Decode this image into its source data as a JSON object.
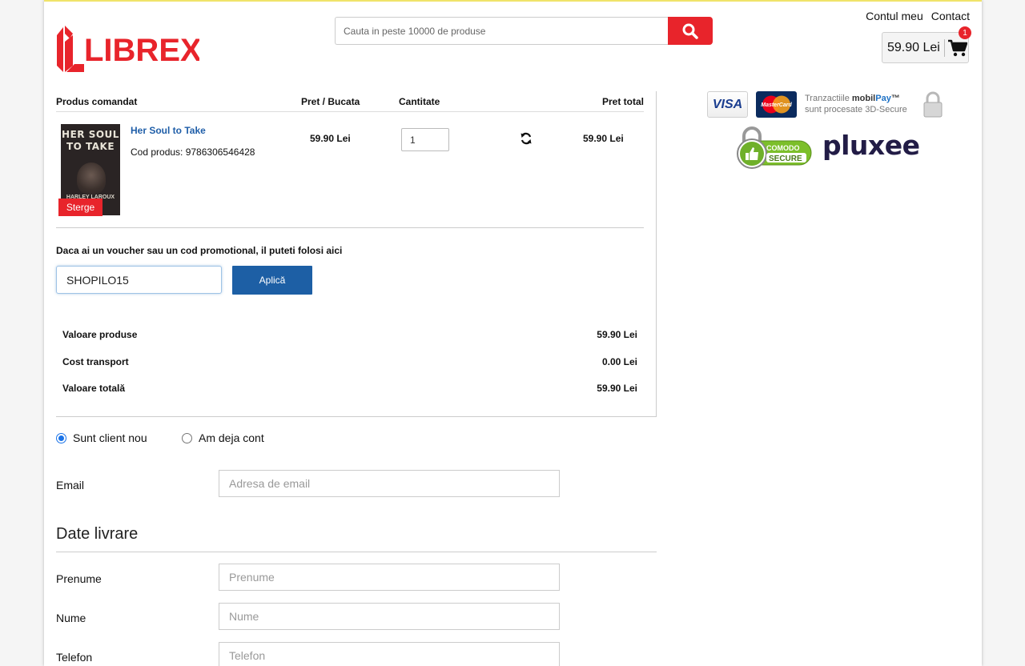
{
  "header": {
    "logo_text": "LIBREX",
    "search_placeholder": "Cauta in peste 10000 de produse",
    "nav": [
      "Contul meu",
      "Contact"
    ],
    "cart_total": "59.90 Lei",
    "cart_count": "1"
  },
  "order": {
    "headers": {
      "product": "Produs comandat",
      "unit_price": "Pret / Bucata",
      "quantity": "Cantitate",
      "total": "Pret total"
    },
    "item": {
      "cover_title": "HER SOUL TO TAKE",
      "cover_author": "HARLEY LAROUX",
      "title": "Her Soul to Take",
      "code": "Cod produs: 9786306546428",
      "unit_price": "59.90 Lei",
      "quantity": "1",
      "total": "59.90 Lei",
      "remove_label": "Sterge"
    },
    "voucher": {
      "label": "Daca ai un voucher sau un cod promotional, il puteti folosi aici",
      "value": "SHOPILO15",
      "apply_label": "Aplică"
    },
    "summary": [
      {
        "label": "Valoare produse",
        "value": "59.90 Lei"
      },
      {
        "label": "Cost transport",
        "value": "0.00 Lei"
      },
      {
        "label": "Valoare totală",
        "value": "59.90 Lei"
      }
    ]
  },
  "badges": {
    "visa": "VISA",
    "mastercard": "MasterCard",
    "mobilpay_line1_prefix": "Tranzactiile ",
    "mobilpay_brand1": "mobil",
    "mobilpay_brand2": "Pay",
    "mobilpay_tm": "™",
    "mobilpay_line2": "sunt procesate 3D-Secure",
    "comodo_top": "COMODO",
    "comodo_bottom": "SECURE",
    "pluxee": "pluxee"
  },
  "form": {
    "radio_new": "Sunt client nou",
    "radio_existing": "Am deja cont",
    "email_label": "Email",
    "email_placeholder": "Adresa de email",
    "delivery_title": "Date livrare",
    "first_name_label": "Prenume",
    "first_name_placeholder": "Prenume",
    "last_name_label": "Nume",
    "last_name_placeholder": "Nume",
    "phone_label": "Telefon",
    "phone_placeholder": "Telefon"
  },
  "colors": {
    "brand_red": "#e8242b",
    "link_blue": "#1f5ea8",
    "button_blue": "#1d5fa5"
  }
}
